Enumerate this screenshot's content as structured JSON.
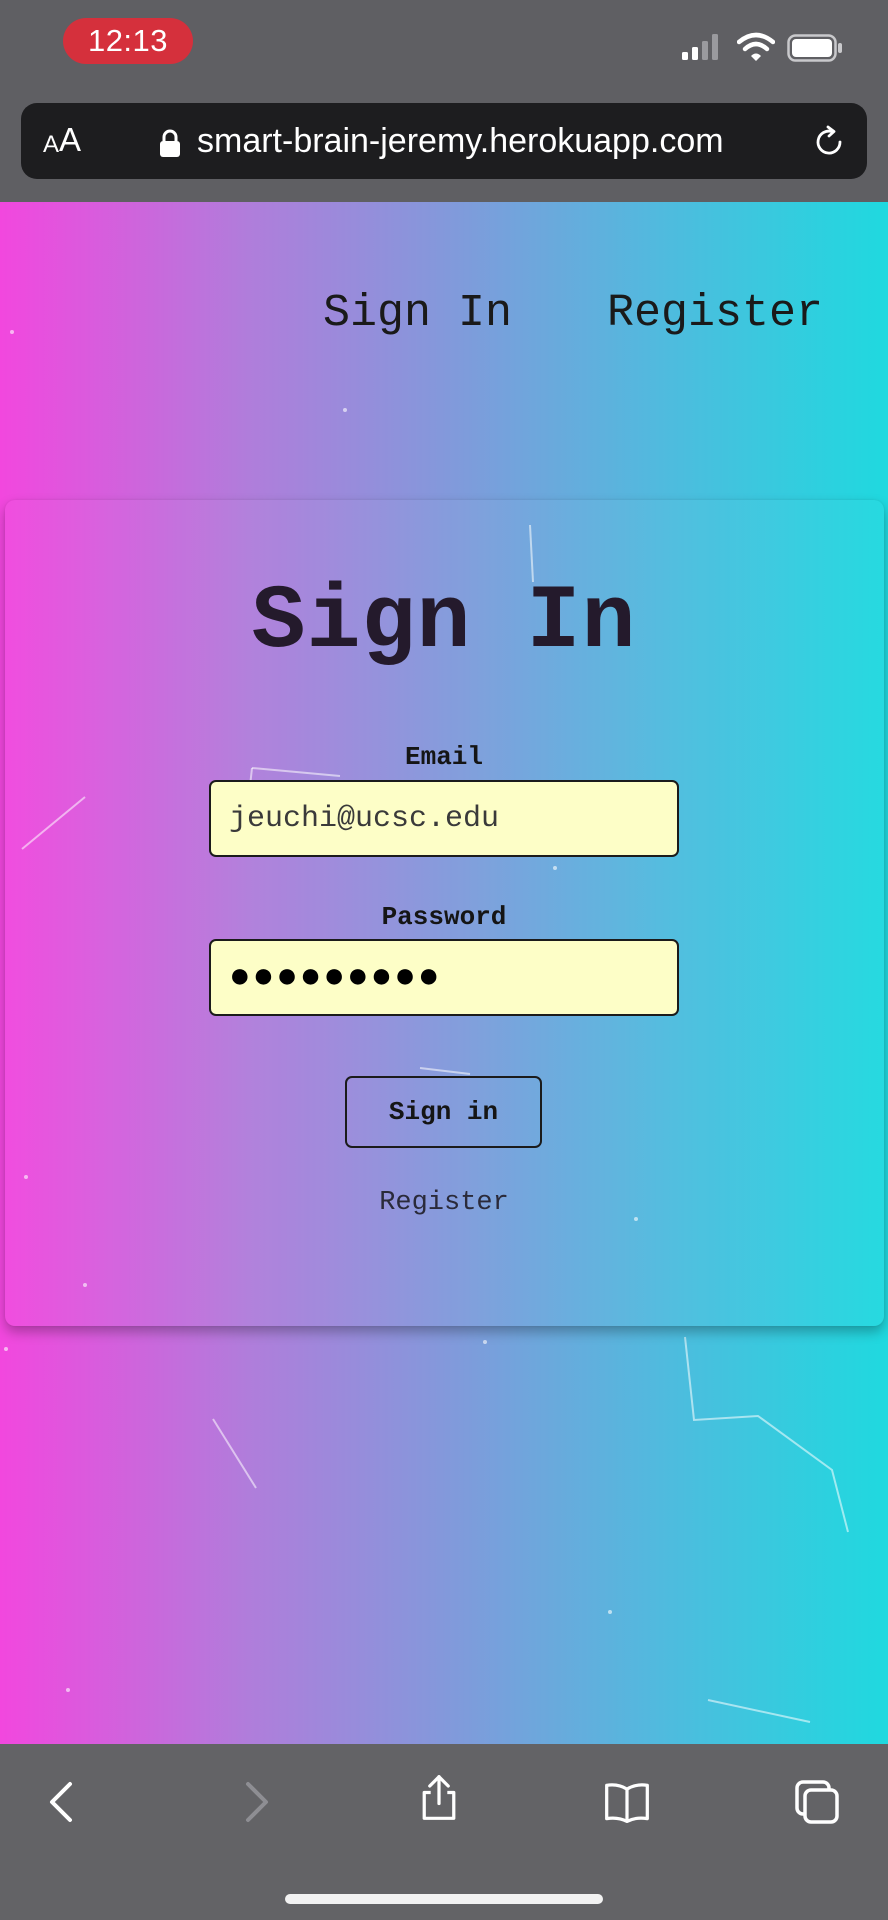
{
  "status_bar": {
    "time": "12:13",
    "icons": [
      "signal-icon",
      "wifi-icon",
      "battery-icon"
    ]
  },
  "browser": {
    "text_size_button_small": "A",
    "text_size_button_large": "A",
    "url": "smart-brain-jeremy.herokuapp.com",
    "icons": [
      "lock-icon",
      "reload-icon"
    ]
  },
  "nav": {
    "sign_in": "Sign In",
    "register": "Register"
  },
  "signin_form": {
    "title": "Sign In",
    "email_label": "Email",
    "email_value": "jeuchi@ucsc.edu",
    "password_label": "Password",
    "password_value": "●●●●●●●●●",
    "submit_label": "Sign in",
    "register_link": "Register"
  },
  "toolbar": {
    "icons": [
      "back-icon",
      "forward-icon",
      "share-icon",
      "bookmarks-icon",
      "tabs-icon"
    ]
  },
  "colors": {
    "gradient_start": "#f247de",
    "gradient_end": "#1fd9df",
    "input_background": "#fdfec7",
    "time_pill": "#d5303c"
  }
}
